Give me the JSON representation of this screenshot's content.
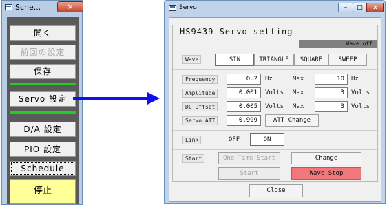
{
  "schedule_window": {
    "title": "Sche...",
    "close_glyph": "×",
    "buttons": {
      "open": "開く",
      "previous_settings": "前回の設定",
      "save": "保存",
      "servo_settings": "Servo 設定",
      "da_settings": "D/A 設定",
      "pio_settings": "PIO 設定",
      "schedule": "Schedule",
      "stop": "停止"
    },
    "accent_line_color": "#22cc22",
    "stop_button_color": "#ffff99"
  },
  "arrow_color": "#1010ee",
  "servo_window": {
    "title": "Servo",
    "min_glyph": "–",
    "max_glyph": "□",
    "close_glyph": "x",
    "group_title": "HS9439 Servo setting",
    "status": "Wave off",
    "wave": {
      "label": "Wave",
      "options": [
        "SIN",
        "TRIANGLE",
        "SQUARE",
        "SWEEP"
      ],
      "selected": "SIN"
    },
    "frequency": {
      "label": "Frequency",
      "value": "0.2",
      "unit": "Hz",
      "max_label": "Max",
      "max_value": "10",
      "max_unit": "Hz"
    },
    "amplitude": {
      "label": "Amplitude",
      "value": "0.001",
      "unit": "Volts",
      "max_label": "Max",
      "max_value": "3",
      "max_unit": "Volts"
    },
    "dc_offset": {
      "label": "DC Offset",
      "value": "0.005",
      "unit": "Volts",
      "max_label": "Max",
      "max_value": "3",
      "max_unit": "Volts"
    },
    "servo_att": {
      "label": "Servo ATT",
      "value": "0.999",
      "button": "ATT Change"
    },
    "link": {
      "label": "Link",
      "off": "OFF",
      "on": "ON",
      "selected": "ON"
    },
    "start": {
      "label": "Start",
      "one_time_start": "One Time Start",
      "change": "Change",
      "start_button": "Start",
      "wave_stop": "Wave Stop"
    },
    "close": "Close",
    "wave_stop_color": "#f0777a"
  }
}
